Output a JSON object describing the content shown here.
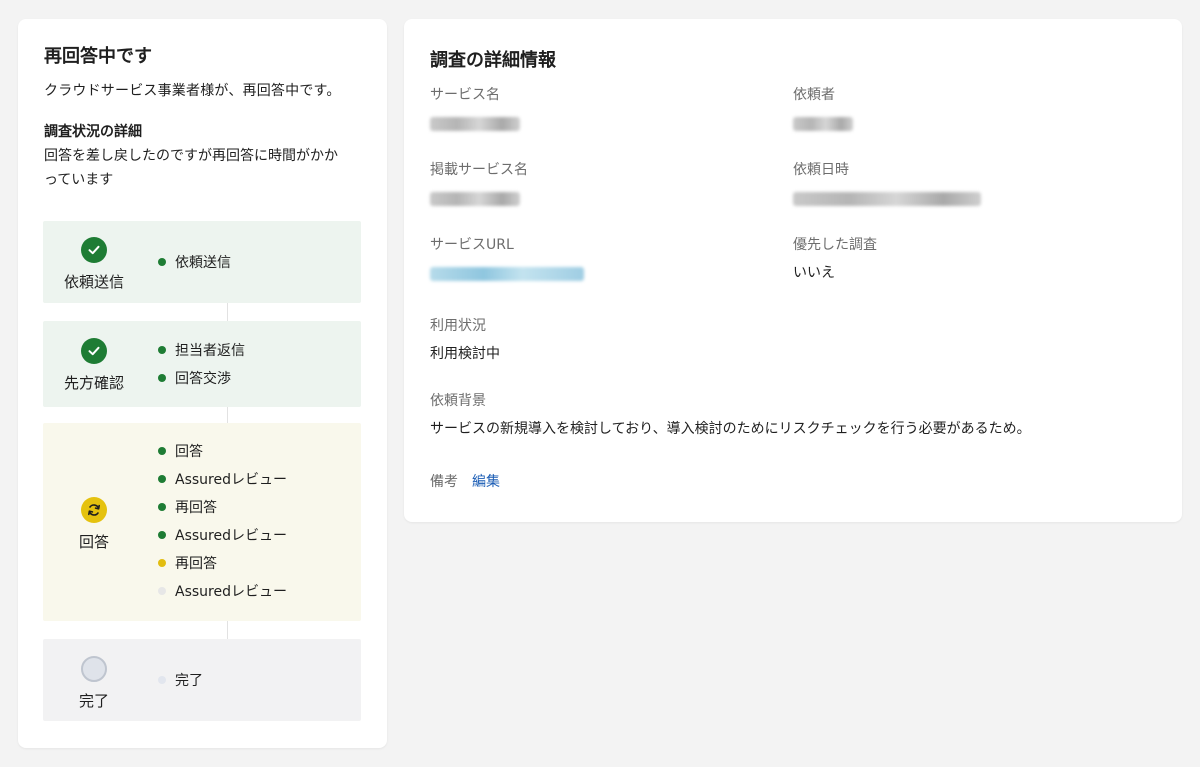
{
  "status": {
    "title": "再回答中です",
    "subtitle": "クラウドサービス事業者様が、再回答中です。",
    "detail_heading": "調査状況の詳細",
    "detail_text": "回答を差し戻したのですが再回答に時間がかかっています"
  },
  "steps": [
    {
      "label": "依頼送信",
      "state": "done",
      "icon": "check-icon",
      "items": [
        {
          "text": "依頼送信",
          "dot": "green"
        }
      ]
    },
    {
      "label": "先方確認",
      "state": "done",
      "icon": "check-icon",
      "items": [
        {
          "text": "担当者返信",
          "dot": "green"
        },
        {
          "text": "回答交渉",
          "dot": "green"
        }
      ]
    },
    {
      "label": "回答",
      "state": "active",
      "icon": "sync-icon",
      "items": [
        {
          "text": "回答",
          "dot": "green"
        },
        {
          "text": "Assuredレビュー",
          "dot": "green"
        },
        {
          "text": "再回答",
          "dot": "green"
        },
        {
          "text": "Assuredレビュー",
          "dot": "green"
        },
        {
          "text": "再回答",
          "dot": "yellow"
        },
        {
          "text": "Assuredレビュー",
          "dot": "grey"
        }
      ]
    },
    {
      "label": "完了",
      "state": "todo",
      "icon": "pending-circle-icon",
      "items": [
        {
          "text": "完了",
          "dot": "light"
        }
      ]
    }
  ],
  "details": {
    "title": "調査の詳細情報",
    "service_name_label": "サービス名",
    "requester_label": "依頼者",
    "listed_service_label": "掲載サービス名",
    "request_datetime_label": "依頼日時",
    "service_url_label": "サービスURL",
    "priority_label": "優先した調査",
    "priority_value": "いいえ",
    "usage_label": "利用状況",
    "usage_value": "利用検討中",
    "background_label": "依頼背景",
    "background_value": "サービスの新規導入を検討しており、導入検討のためにリスクチェックを行う必要があるため。",
    "notes_label": "備考",
    "edit_label": "編集"
  },
  "colors": {
    "done_green": "#1e7c34",
    "active_yellow": "#e5c20f",
    "link_blue": "#1b5db5"
  }
}
